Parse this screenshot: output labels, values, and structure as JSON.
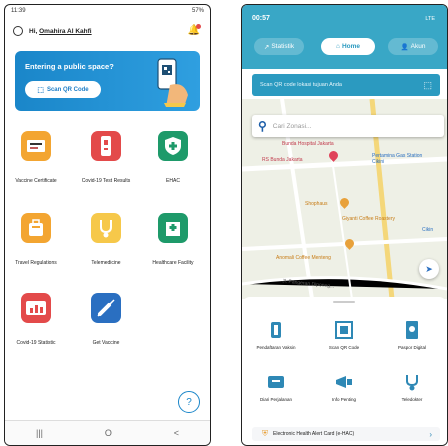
{
  "left": {
    "status": {
      "time": "11:39",
      "battery": "57%"
    },
    "greeting": "Hi,",
    "user_name": "Omahira Al Kahfi",
    "banner": {
      "title": "Entering a public space?",
      "button": "Scan QR Code"
    },
    "features": [
      {
        "label": "Vaccine Certificate"
      },
      {
        "label": "Covid-19 Test Results"
      },
      {
        "label": "EHAC"
      },
      {
        "label": "Travel Regulations"
      },
      {
        "label": "Telemedicine"
      },
      {
        "label": "Healthcare Facility"
      },
      {
        "label": "Covid-19 Statistic"
      },
      {
        "label": "Get Vaccine"
      }
    ],
    "colors": {
      "accent": "#1a86c9",
      "orange": "#f3a531",
      "red": "#e34a4a",
      "green": "#1e9a6a",
      "blue": "#2a6fc1"
    },
    "nav": {
      "recent": "|||",
      "home": "O",
      "back": "<"
    },
    "help_icon": "?"
  },
  "right": {
    "status": {
      "time": "00:57",
      "network": "LTE"
    },
    "tabs": {
      "stat": "Statistik",
      "home": "Home",
      "account": "Akun"
    },
    "qr_bar": "Scan QR code lokasi tujuan Anda",
    "search_placeholder": "Cari Zonasi...",
    "map_labels": {
      "hospital": "Bunda Hospital Jakarta",
      "rs": "RS Bunda Jakarta",
      "pertamina": "Pertamina Gas Station Cikini",
      "shophaus": "Shophaus",
      "giyanti": "Giyanti Coffee Roastery",
      "anomali": "Anomali Coffee Menteng",
      "pangeran": "Jl. Pangeran Diponeg...",
      "cikini": "Cikin"
    },
    "menu": [
      {
        "label": "Pendaftaran Vaksin"
      },
      {
        "label": "Scan QR Code"
      },
      {
        "label": "Paspor Digital"
      },
      {
        "label": "Diari Perjalanan"
      },
      {
        "label": "Info Penting"
      },
      {
        "label": "Teledokter"
      }
    ],
    "ehac": "Electronic Health Alert Card (e-HAC)",
    "colors": {
      "header": "#39a7c6",
      "icon_blue": "#2e88b5"
    }
  }
}
